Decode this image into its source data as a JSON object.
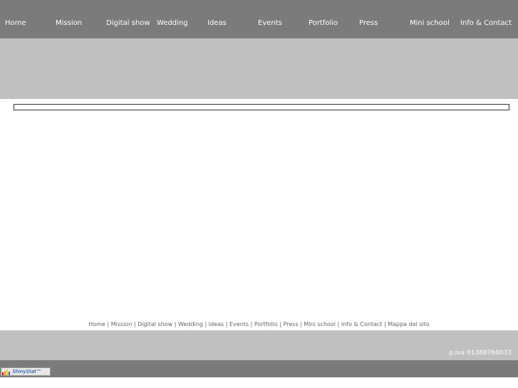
{
  "nav": {
    "items": [
      {
        "label": "Home"
      },
      {
        "label": "Mission"
      },
      {
        "label": "Digital show"
      },
      {
        "label": "Wedding"
      },
      {
        "label": "Ideas"
      },
      {
        "label": "Events"
      },
      {
        "label": "Portfolio"
      },
      {
        "label": "Press"
      },
      {
        "label": "Mini school"
      },
      {
        "label": "Info & Contact"
      }
    ]
  },
  "footer": {
    "links": [
      {
        "label": "Home"
      },
      {
        "label": "Mission"
      },
      {
        "label": "Digital show"
      },
      {
        "label": "Wedding"
      },
      {
        "label": "Ideas"
      },
      {
        "label": "Events"
      },
      {
        "label": "Portfolio"
      },
      {
        "label": "Press"
      },
      {
        "label": "Mini school"
      },
      {
        "label": "Info & Contact"
      },
      {
        "label": "Mappa del sito"
      }
    ],
    "separator": "|",
    "piva": "p.iva  01388760033"
  },
  "badge": {
    "label": "ShinyStat™"
  },
  "colors": {
    "nav_bg": "#7b7b7b",
    "banner_bg": "#c0c0c0"
  }
}
